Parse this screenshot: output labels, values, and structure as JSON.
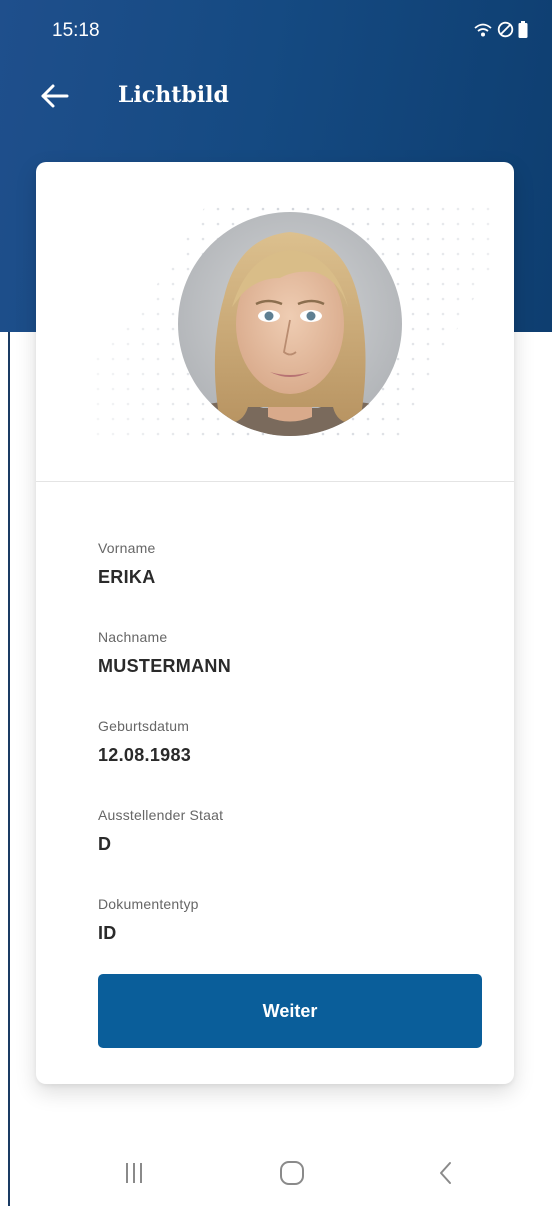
{
  "status_bar": {
    "time": "15:18",
    "icons": [
      "wifi-icon",
      "do-not-disturb-icon",
      "battery-icon"
    ]
  },
  "app_bar": {
    "title": "Lichtbild",
    "back_icon": "arrow-left-icon"
  },
  "card": {
    "photo": {
      "icon": "portrait-photo"
    },
    "fields": [
      {
        "label": "Vorname",
        "value": "ERIKA"
      },
      {
        "label": "Nachname",
        "value": "MUSTERMANN"
      },
      {
        "label": "Geburtsdatum",
        "value": "12.08.1983"
      },
      {
        "label": "Ausstellender Staat",
        "value": "D"
      },
      {
        "label": "Dokumententyp",
        "value": "ID"
      }
    ],
    "continue_label": "Weiter"
  },
  "nav_bar": {
    "icons": [
      "recents-icon",
      "home-icon",
      "back-icon"
    ]
  },
  "colors": {
    "header": "#154a82",
    "primary_button": "#0a5e9a",
    "label": "#666666",
    "value": "#2a2a2a"
  }
}
